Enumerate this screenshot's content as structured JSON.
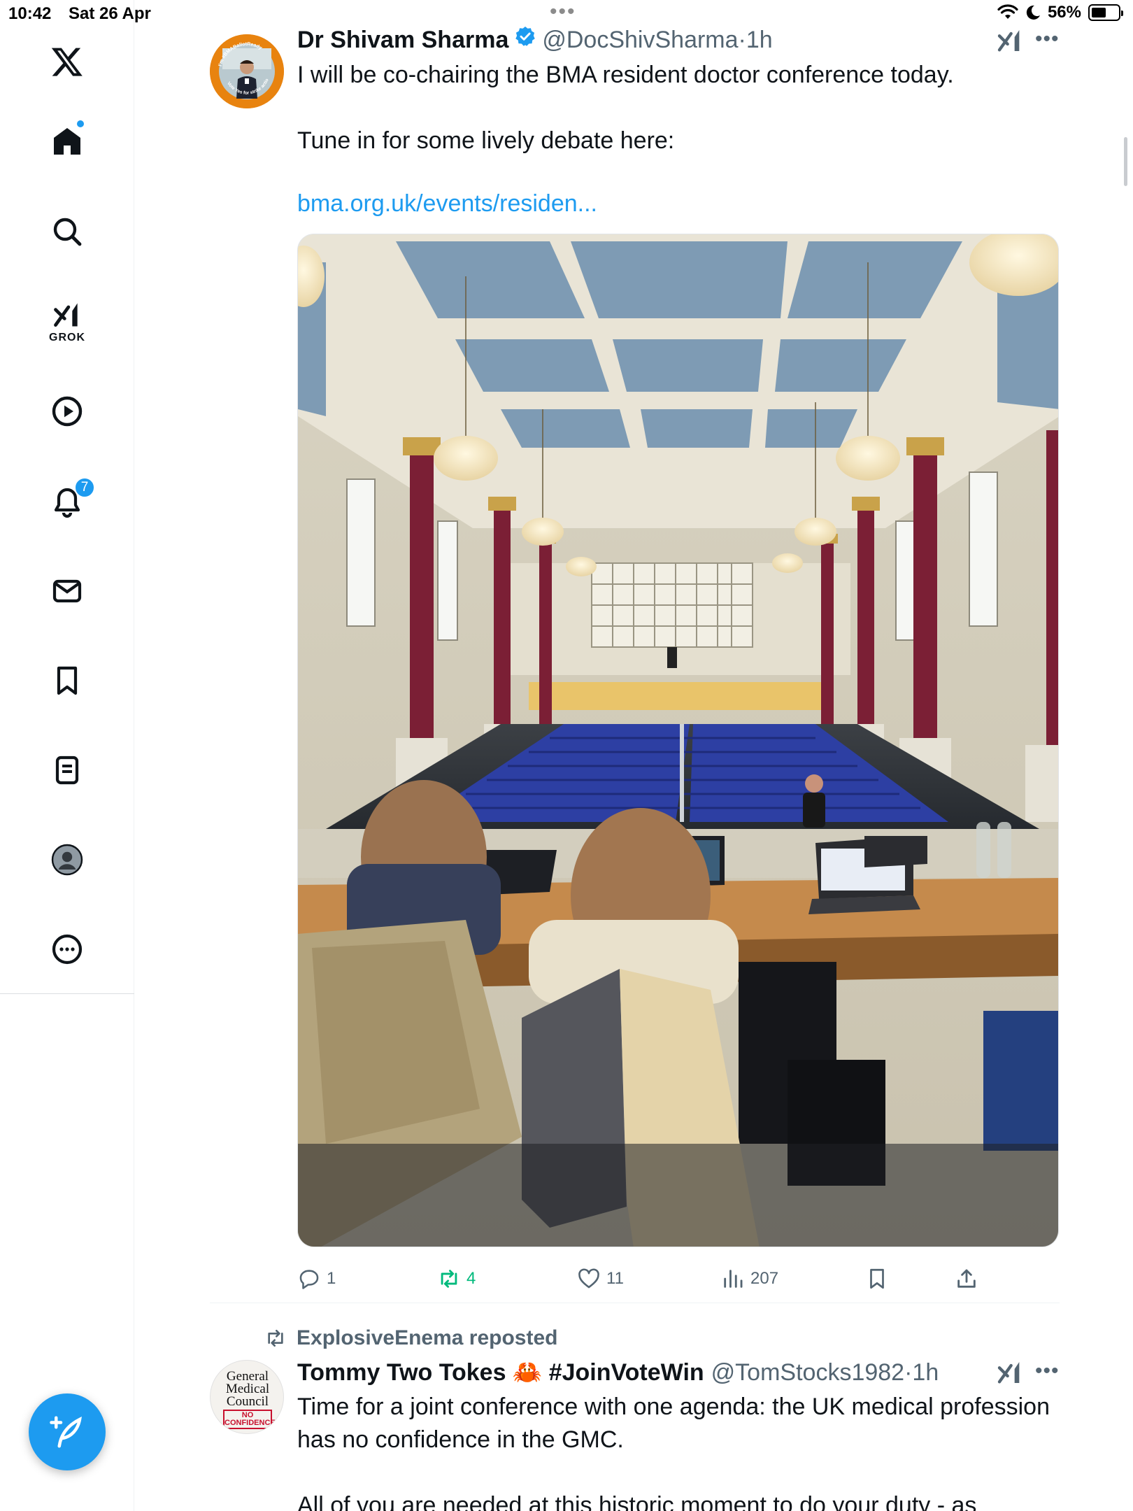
{
  "status_bar": {
    "time": "10:42",
    "date": "Sat 26 Apr",
    "battery": "56%",
    "battery_level": 0.56
  },
  "sidebar": {
    "items": [
      {
        "name": "x-logo",
        "icon": "x-logo-icon"
      },
      {
        "name": "home",
        "icon": "home-icon",
        "has_dot": true
      },
      {
        "name": "search",
        "icon": "search-icon"
      },
      {
        "name": "grok",
        "icon": "grok-icon",
        "label": "GROK"
      },
      {
        "name": "videos",
        "icon": "play-icon"
      },
      {
        "name": "notifications",
        "icon": "bell-icon",
        "badge": "7"
      },
      {
        "name": "messages",
        "icon": "envelope-icon"
      },
      {
        "name": "bookmarks",
        "icon": "bookmark-icon"
      },
      {
        "name": "lists",
        "icon": "list-icon"
      },
      {
        "name": "profile",
        "icon": "profile-icon"
      },
      {
        "name": "more",
        "icon": "more-circle-icon"
      }
    ],
    "compose_icon": "compose-icon"
  },
  "colors": {
    "accent": "#1d9bf0",
    "text": "#0f1419",
    "muted": "#536471",
    "repost_active": "#00ba7c"
  },
  "tweets": [
    {
      "display_name": "Dr Shivam Sharma",
      "verified": true,
      "handle": "@DocShivSharma",
      "separator": "·",
      "time": "1h",
      "text": "I will be co-chairing the BMA resident doctor conference today.\n\nTune in for some lively debate here:",
      "link": "bma.org.uk/events/residen...",
      "avatar_ring_text": "I'm #BMABallotReady",
      "avatar_ring_text_2": "Vote Yes for strike action",
      "media_icon": "conference-hall-photo",
      "actions": {
        "replies": "1",
        "reposts": "4",
        "likes": "11",
        "views": "207"
      }
    },
    {
      "reposted_by": "ExplosiveEnema reposted",
      "display_name": "Tommy Two Tokes 🦀 #JoinVoteWin",
      "handle": "@TomStocks1982",
      "separator": "·",
      "time": "1h",
      "avatar_lines": [
        "General",
        "Medical",
        "Council"
      ],
      "avatar_stamp": [
        "NO",
        "CONFIDENCE"
      ],
      "text": "Time for a joint conference with one agenda: the UK medical profession has no confidence in the GMC.\n\nAll of you are needed at this historic moment to do your duty - as"
    }
  ]
}
